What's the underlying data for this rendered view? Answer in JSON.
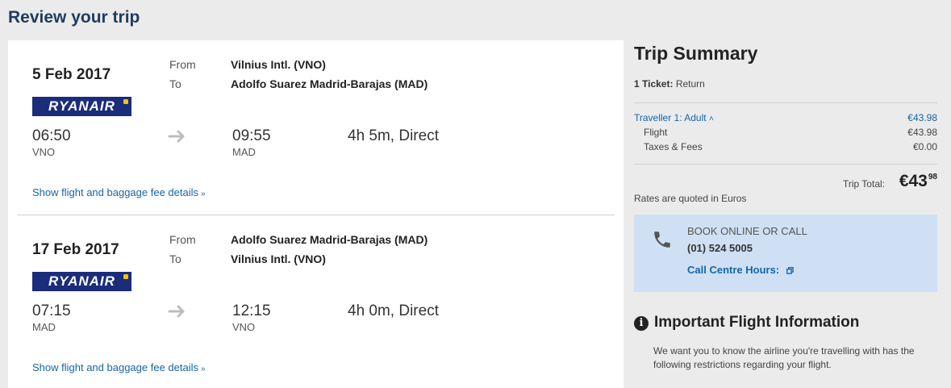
{
  "page": {
    "title": "Review your trip"
  },
  "legs": [
    {
      "date": "5 Feb 2017",
      "airline": "RYANAIR",
      "from_label": "From",
      "to_label": "To",
      "from": "Vilnius Intl. (VNO)",
      "to": "Adolfo Suarez Madrid-Barajas (MAD)",
      "dep_time": "06:50",
      "dep_code": "VNO",
      "arr_time": "09:55",
      "arr_code": "MAD",
      "duration": "4h 5m, Direct",
      "details_link": "Show flight and baggage fee details"
    },
    {
      "date": "17 Feb 2017",
      "airline": "RYANAIR",
      "from_label": "From",
      "to_label": "To",
      "from": "Adolfo Suarez Madrid-Barajas (MAD)",
      "to": "Vilnius Intl. (VNO)",
      "dep_time": "07:15",
      "dep_code": "MAD",
      "arr_time": "12:15",
      "arr_code": "VNO",
      "duration": "4h 0m, Direct",
      "details_link": "Show flight and baggage fee details"
    }
  ],
  "summary": {
    "title": "Trip Summary",
    "ticket_label": "1 Ticket:",
    "ticket_type": "Return",
    "traveller": "Traveller 1: Adult",
    "traveller_amount": "€43.98",
    "flight_label": "Flight",
    "flight_amount": "€43.98",
    "taxes_label": "Taxes & Fees",
    "taxes_amount": "€0.00",
    "total_label": "Trip Total:",
    "total_main": "€43",
    "total_cents": "98",
    "rates_note": "Rates are quoted in Euros"
  },
  "call": {
    "label": "BOOK ONLINE OR CALL",
    "number": "(01) 524 5005",
    "hours_link": "Call Centre Hours:"
  },
  "info": {
    "icon": "i",
    "title": "Important Flight Information",
    "text": "We want you to know the airline you're travelling with has the following restrictions regarding your flight."
  },
  "colors": {
    "link": "#1565a8",
    "heading": "#1f3c5c",
    "callbox": "#cfe0f5",
    "airline": "#1b2c7a"
  }
}
